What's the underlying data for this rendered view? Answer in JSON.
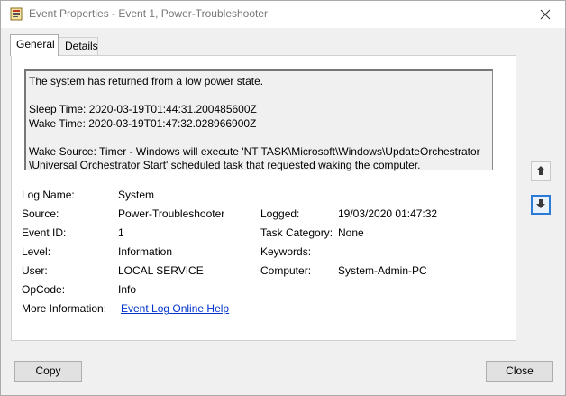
{
  "window": {
    "title": "Event Properties - Event 1, Power-Troubleshooter"
  },
  "tabs": [
    {
      "label": "General",
      "selected": true
    },
    {
      "label": "Details",
      "selected": false
    }
  ],
  "description": {
    "line1": "The system has returned from a low power state.",
    "sleep_time": "Sleep Time: 2020-03-19T01:44:31.200485600Z",
    "wake_time": "Wake Time: 2020-03-19T01:47:32.028966900Z",
    "wake_source_1": "Wake Source: Timer - Windows will execute 'NT TASK\\Microsoft\\Windows\\UpdateOrchestrator",
    "wake_source_2": "\\Universal Orchestrator Start' scheduled task that requested waking the computer."
  },
  "fields": {
    "log_name_label": "Log Name:",
    "log_name_value": "System",
    "source_label": "Source:",
    "source_value": "Power-Troubleshooter",
    "logged_label": "Logged:",
    "logged_value": "19/03/2020 01:47:32",
    "event_id_label": "Event ID:",
    "event_id_value": "1",
    "task_category_label": "Task Category:",
    "task_category_value": "None",
    "level_label": "Level:",
    "level_value": "Information",
    "keywords_label": "Keywords:",
    "keywords_value": "",
    "user_label": "User:",
    "user_value": "LOCAL SERVICE",
    "computer_label": "Computer:",
    "computer_value": "System-Admin-PC",
    "opcode_label": "OpCode:",
    "opcode_value": "Info",
    "more_info_label": "More Information:",
    "more_info_link": "Event Log Online Help"
  },
  "buttons": {
    "copy": "Copy",
    "close": "Close"
  },
  "icons": {
    "app": "event-viewer-icon",
    "close": "close-icon",
    "up": "arrow-up-icon",
    "down": "arrow-down-icon"
  },
  "colors": {
    "link": "#0033cc",
    "focus": "#2b7bd6"
  }
}
